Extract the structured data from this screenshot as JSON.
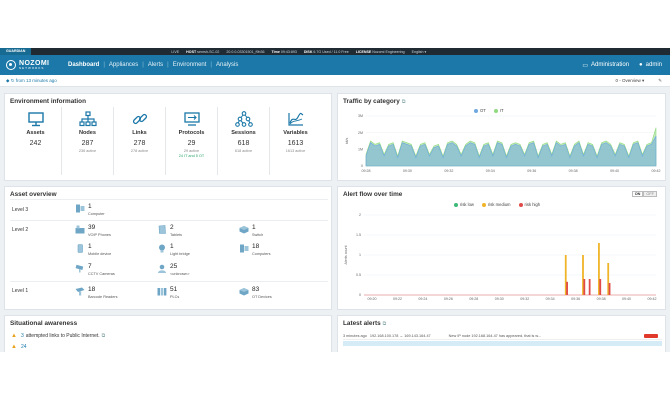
{
  "statusbar": {
    "brand": "GUARDIAN",
    "live": "LIVE",
    "host_label": "HOST",
    "host_value": "senrsh-SC-02",
    "version": "20.0.0-03301501_f9b36",
    "time_label": "Time",
    "time_value": "09:43:893",
    "disk_label": "DISK",
    "disk_value": "6.7G Used / 11.0 Free",
    "license_label": "LICENSE",
    "license_value": "Nozomi Engineering",
    "language": "English ▾"
  },
  "nav": {
    "logo_line1": "NOZOMI",
    "logo_line2": "NETWORKS",
    "items": [
      "Dashboard",
      "Appliances",
      "Alerts",
      "Environment",
      "Analysis"
    ],
    "administration": "Administration",
    "user": "admin"
  },
  "subbar": {
    "updated": "from 13 minutes ago",
    "overview_select": "0 - Overview ▾"
  },
  "env": {
    "title": "Environment information",
    "cells": [
      {
        "icon": "monitor-icon",
        "label": "Assets",
        "value": "242",
        "sub": "",
        "sub2": ""
      },
      {
        "icon": "nodes-icon",
        "label": "Nodes",
        "value": "287",
        "sub": "236 active",
        "sub2": ""
      },
      {
        "icon": "link-icon",
        "label": "Links",
        "value": "278",
        "sub": "278 active",
        "sub2": ""
      },
      {
        "icon": "protocols-icon",
        "label": "Protocols",
        "value": "29",
        "sub": "29 active",
        "sub2": "24 IT and 5 OT"
      },
      {
        "icon": "sessions-icon",
        "label": "Sessions",
        "value": "618",
        "sub": "618 active",
        "sub2": ""
      },
      {
        "icon": "variables-icon",
        "label": "Variables",
        "value": "1613",
        "sub": "1613 active",
        "sub2": ""
      }
    ]
  },
  "traffic": {
    "title": "Traffic by category",
    "legend": [
      {
        "name": "OT",
        "color": "#6ea8e0"
      },
      {
        "name": "IT",
        "color": "#8fd97f"
      }
    ]
  },
  "assets": {
    "title": "Asset overview",
    "levels": [
      "Level 3",
      "Level 2",
      "Level 1"
    ],
    "tiles": [
      {
        "icon": "computer-icon",
        "count": "1",
        "label": "Computer"
      },
      {
        "icon": "voip-phone-icon",
        "count": "39",
        "label": "VOIP Phones"
      },
      {
        "icon": "tablet-icon",
        "count": "2",
        "label": "Tablets"
      },
      {
        "icon": "switch-icon",
        "count": "1",
        "label": "Switch"
      },
      {
        "icon": "mobile-icon",
        "count": "1",
        "label": "Mobile device"
      },
      {
        "icon": "light-bridge-icon",
        "count": "1",
        "label": "Light bridge"
      },
      {
        "icon": "computers-icon",
        "count": "18",
        "label": "Computers"
      },
      {
        "icon": "cctv-icon",
        "count": "7",
        "label": "CCTV Cameras"
      },
      {
        "icon": "unknown-icon",
        "count": "25",
        "label": "<unknown>"
      },
      {
        "icon": "barcode-reader-icon",
        "count": "18",
        "label": "Barcode Readers"
      },
      {
        "icon": "plc-icon",
        "count": "51",
        "label": "PLCs"
      },
      {
        "icon": "ot-device-icon",
        "count": "83",
        "label": "OT Devices"
      }
    ]
  },
  "alertflow": {
    "title": "Alert flow over time",
    "toggle_on": "ON",
    "toggle_off": "OFF",
    "legend": [
      {
        "name": "risk low",
        "color": "#3cb878"
      },
      {
        "name": "risk medium",
        "color": "#f0b429"
      },
      {
        "name": "risk high",
        "color": "#e04a4a"
      }
    ]
  },
  "chart_data": [
    {
      "type": "area",
      "title": "Traffic by category",
      "ylabel": "bit/s",
      "ylim": [
        0,
        3
      ],
      "y_unit": "M",
      "yticks": [
        "3M",
        "2M",
        "1M",
        "0"
      ],
      "xticks": [
        "09:28",
        "09:30",
        "09:32",
        "09:34",
        "09:36",
        "09:38",
        "09:40",
        "09:42"
      ],
      "series": [
        {
          "name": "OT",
          "color": "#6ea8e0",
          "values": [
            0.6,
            1.4,
            1.2,
            1.3,
            0.6,
            1.2,
            1.3,
            0.5,
            1.4,
            1.3,
            1.2,
            0.5,
            1.2,
            1.3,
            0.6,
            1.1,
            1.2,
            0.5,
            1.3,
            1.4,
            1.2,
            0.6,
            1.2,
            1.4,
            1.3,
            0.5,
            1.2,
            1.3,
            0.6,
            1.4,
            1.3,
            0.5,
            1.2,
            1.3,
            1.2,
            0.6,
            1.3,
            1.4,
            0.5,
            1.2,
            1.3,
            0.6,
            1.4,
            1.2,
            1.3,
            0.5,
            1.2,
            1.4,
            0.6,
            1.3,
            1.2,
            0.5,
            1.3,
            1.4,
            1.2,
            0.6,
            1.3,
            1.2,
            0.5,
            1.3,
            1.4,
            0.6,
            1.2,
            1.3,
            1.8
          ]
        },
        {
          "name": "IT",
          "color": "#8fd97f",
          "values": [
            0.7,
            1.5,
            1.3,
            1.4,
            0.7,
            1.3,
            1.4,
            0.6,
            1.5,
            1.4,
            1.3,
            0.6,
            1.3,
            1.4,
            0.7,
            1.2,
            1.3,
            0.6,
            1.4,
            1.5,
            1.3,
            0.7,
            1.3,
            1.5,
            1.4,
            0.6,
            1.3,
            1.4,
            0.7,
            1.5,
            1.4,
            0.6,
            1.3,
            1.4,
            1.3,
            0.7,
            1.4,
            1.5,
            0.6,
            1.3,
            1.4,
            0.7,
            1.5,
            1.3,
            1.4,
            0.6,
            1.3,
            1.5,
            0.7,
            1.4,
            1.3,
            0.6,
            1.4,
            1.5,
            1.3,
            0.7,
            1.4,
            1.3,
            0.6,
            1.4,
            1.5,
            0.7,
            1.3,
            1.4,
            2.3
          ]
        }
      ]
    },
    {
      "type": "bar",
      "title": "Alert flow over time",
      "ylabel": "Alerts count",
      "ylim": [
        0,
        2
      ],
      "yticks": [
        "2",
        "1.5",
        "1",
        "0.5",
        "0"
      ],
      "xticks": [
        "09:20",
        "09:22",
        "09:24",
        "09:26",
        "09:28",
        "09:30",
        "09:32",
        "09:34",
        "09:36",
        "09:38",
        "09:40",
        "09:42"
      ],
      "x_min": 0,
      "x_max": 22,
      "series": [
        {
          "name": "risk medium",
          "color": "#f0b429",
          "points": [
            [
              15.2,
              1.0
            ],
            [
              16.5,
              1.0
            ],
            [
              17.7,
              1.3
            ],
            [
              18.4,
              0.8
            ]
          ]
        },
        {
          "name": "risk high",
          "color": "#e04a4a",
          "points": [
            [
              15.3,
              0.33
            ],
            [
              16.6,
              0.4
            ],
            [
              17.0,
              0.4
            ],
            [
              17.8,
              0.4
            ],
            [
              18.5,
              0.3
            ]
          ]
        }
      ]
    }
  ],
  "situational": {
    "title": "Situational awareness",
    "row1_count": "3",
    "row1_text": "attempted links to Public Internet.",
    "row2_count": "24"
  },
  "alerts": {
    "title": "Latest alerts",
    "row_time": "3 minutes ago",
    "row_hosts": "192.168.100.178 → 169.143.164.47",
    "row_msg": "New IP node 192.168.164.47 has appeared, that is w..."
  }
}
